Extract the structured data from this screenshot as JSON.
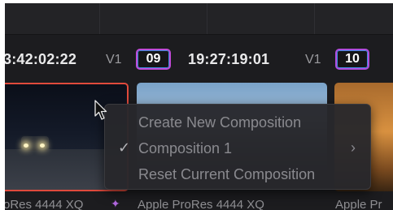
{
  "timecodes": {
    "clip_left": "3:42:02:22",
    "clip_mid": "19:27:19:01"
  },
  "tracks": {
    "left": "V1",
    "right": "V1"
  },
  "badges": {
    "first": "09",
    "second": "10"
  },
  "clips": {
    "left_label": "oRes 4444 XQ",
    "mid_label": "Apple ProRes 4444 XQ",
    "right_label": "Apple Pr"
  },
  "context_menu": {
    "items": [
      {
        "label": "Create New Composition",
        "checked": false,
        "submenu": false
      },
      {
        "label": "Composition 1",
        "checked": true,
        "submenu": true
      },
      {
        "label": "Reset Current Composition",
        "checked": false,
        "submenu": false
      }
    ],
    "check_glyph": "✓",
    "submenu_glyph": "›"
  },
  "colors": {
    "selected_clip_border": "#e04a3c",
    "badge_border": "#c04bd8",
    "background": "#1c1c1f"
  }
}
